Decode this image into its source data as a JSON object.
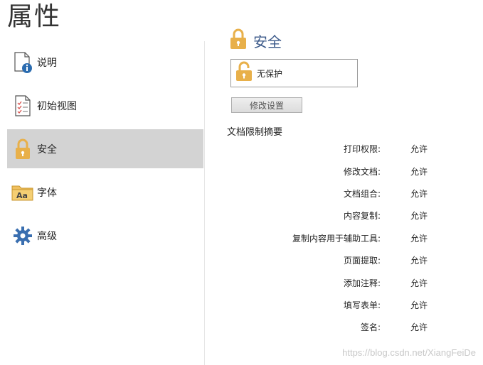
{
  "title": "属性",
  "sidebar": {
    "items": [
      {
        "label": "说明",
        "icon": "description-info-icon"
      },
      {
        "label": "初始视图",
        "icon": "initial-view-checklist-icon"
      },
      {
        "label": "安全",
        "icon": "lock-icon",
        "selected": true
      },
      {
        "label": "字体",
        "icon": "font-folder-icon"
      },
      {
        "label": "高级",
        "icon": "gear-icon"
      }
    ]
  },
  "security": {
    "header_title": "安全",
    "status_text": "无保护",
    "change_button_label": "修改设置",
    "summary_title": "文档限制摘要",
    "rows": [
      {
        "label": "打印权限:",
        "value": "允许"
      },
      {
        "label": "修改文档:",
        "value": "允许"
      },
      {
        "label": "文档组合:",
        "value": "允许"
      },
      {
        "label": "内容复制:",
        "value": "允许"
      },
      {
        "label": "复制内容用于辅助工具:",
        "value": "允许"
      },
      {
        "label": "页面提取:",
        "value": "允许"
      },
      {
        "label": "添加注释:",
        "value": "允许"
      },
      {
        "label": "填写表单:",
        "value": "允许"
      },
      {
        "label": "签名:",
        "value": "允许"
      }
    ]
  },
  "watermark": "https://blog.csdn.net/XiangFeiDe",
  "colors": {
    "selected_bg": "#d3d3d3",
    "header_text": "#3c5a8a",
    "lock_gold": "#e8b04a"
  }
}
